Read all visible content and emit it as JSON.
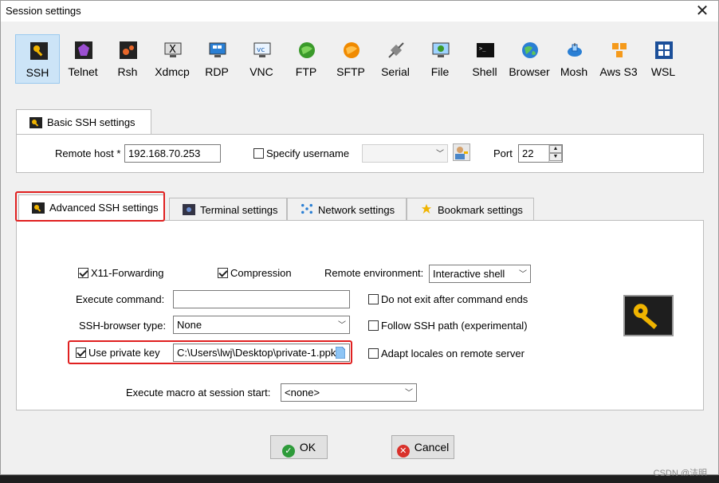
{
  "window": {
    "title": "Session settings"
  },
  "session_types": [
    {
      "label": "SSH",
      "icon": "key-icon",
      "active": true
    },
    {
      "label": "Telnet",
      "icon": "telnet-icon"
    },
    {
      "label": "Rsh",
      "icon": "rsh-icon"
    },
    {
      "label": "Xdmcp",
      "icon": "xdmcp-icon"
    },
    {
      "label": "RDP",
      "icon": "rdp-icon"
    },
    {
      "label": "VNC",
      "icon": "vnc-icon"
    },
    {
      "label": "FTP",
      "icon": "ftp-globe-icon"
    },
    {
      "label": "SFTP",
      "icon": "sftp-globe-icon"
    },
    {
      "label": "Serial",
      "icon": "serial-plug-icon"
    },
    {
      "label": "File",
      "icon": "file-monitor-icon"
    },
    {
      "label": "Shell",
      "icon": "shell-terminal-icon"
    },
    {
      "label": "Browser",
      "icon": "browser-globe-icon"
    },
    {
      "label": "Mosh",
      "icon": "satellite-icon"
    },
    {
      "label": "Aws S3",
      "icon": "aws-cubes-icon"
    },
    {
      "label": "WSL",
      "icon": "windows-icon"
    }
  ],
  "basic": {
    "tab_label": "Basic SSH settings",
    "remote_host_label": "Remote host *",
    "remote_host_value": "192.168.70.253",
    "specify_username_label": "Specify username",
    "port_label": "Port",
    "port_value": "22"
  },
  "tabs": [
    {
      "label": "Advanced SSH settings",
      "active": true
    },
    {
      "label": "Terminal settings"
    },
    {
      "label": "Network settings"
    },
    {
      "label": "Bookmark settings"
    }
  ],
  "advanced": {
    "x11_label": "X11-Forwarding",
    "compression_label": "Compression",
    "remote_env_label": "Remote environment:",
    "remote_env_value": "Interactive shell",
    "exec_cmd_label": "Execute command:",
    "exec_cmd_value": "",
    "no_exit_label": "Do not exit after command ends",
    "browser_type_label": "SSH-browser type:",
    "browser_type_value": "None",
    "follow_path_label": "Follow SSH path (experimental)",
    "private_key_label": "Use private key",
    "private_key_value": "C:\\Users\\lwj\\Desktop\\private-1.ppk",
    "adapt_locales_label": "Adapt locales on remote server",
    "macro_label": "Execute macro at session start:",
    "macro_value": "<none>"
  },
  "buttons": {
    "ok": "OK",
    "cancel": "Cancel"
  },
  "watermark": "CSDN @洁明",
  "colors": {
    "highlight_red": "#e02020",
    "active_tab_bg": "#cce4f7",
    "key_gold": "#f0b400"
  }
}
